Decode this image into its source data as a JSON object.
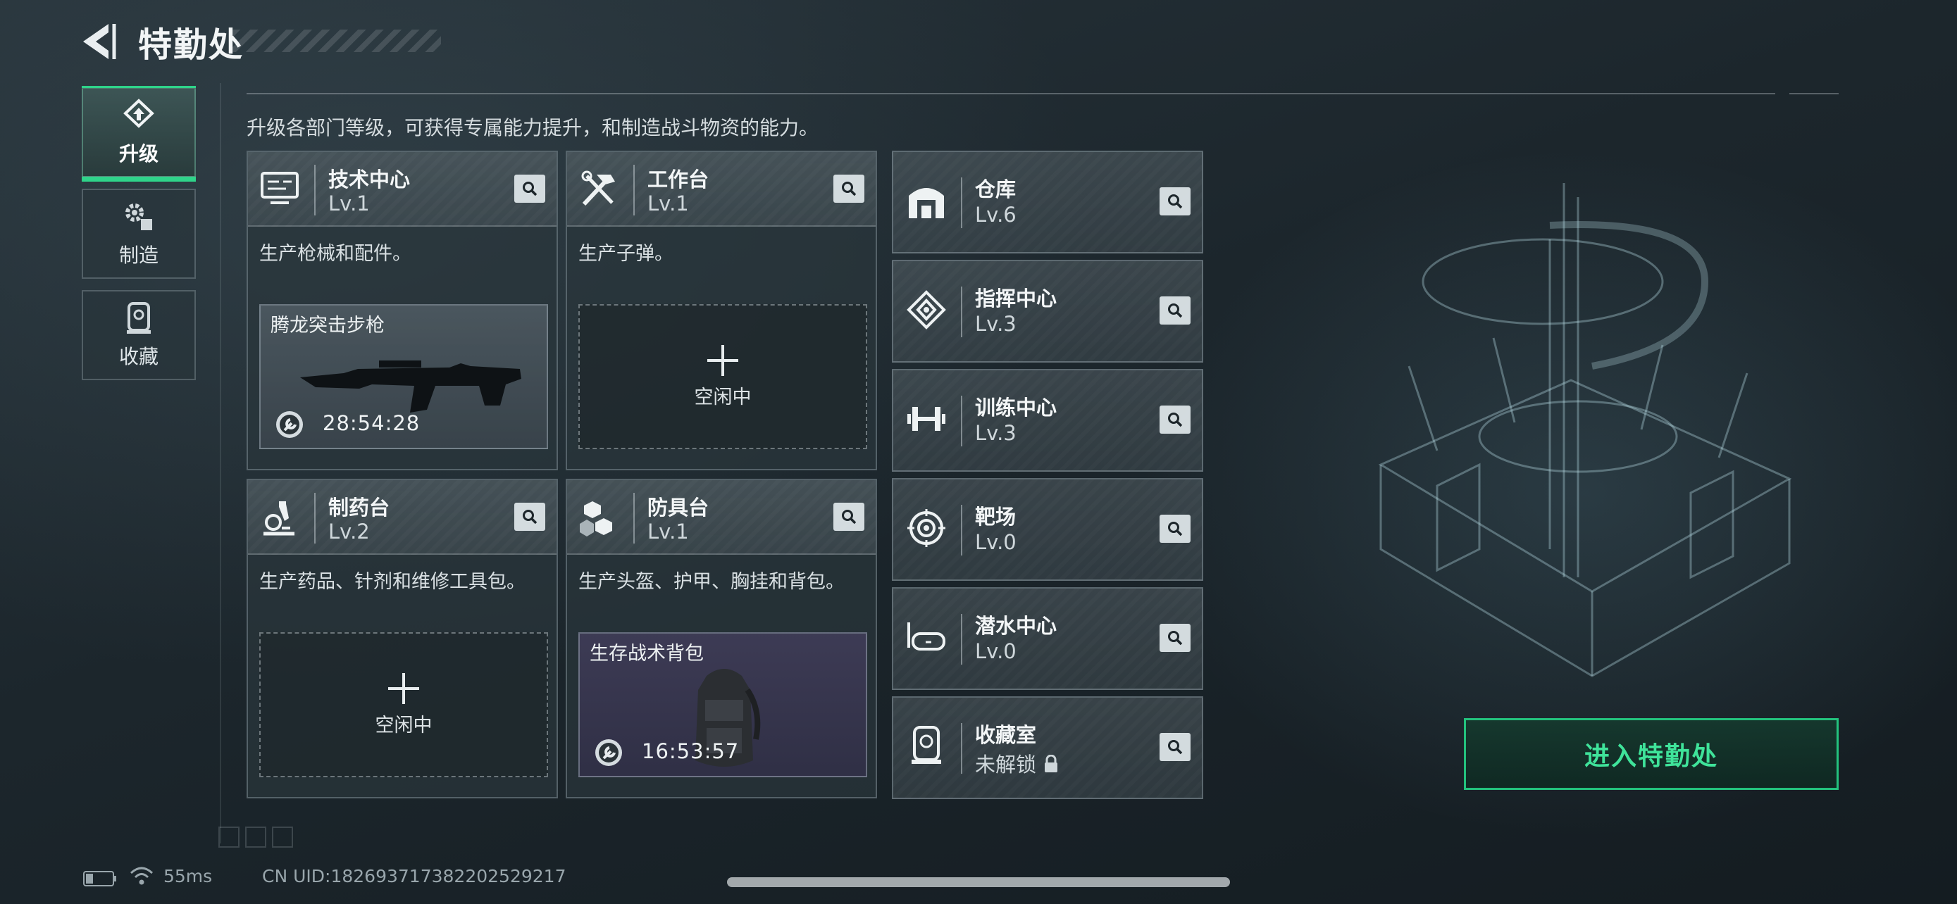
{
  "header": {
    "title": "特勤处",
    "back_icon": "back-arrow-icon"
  },
  "nav": [
    {
      "label": "升级",
      "icon": "upgrade-icon",
      "active": true
    },
    {
      "label": "制造",
      "icon": "gears-icon",
      "active": false
    },
    {
      "label": "收藏",
      "icon": "collection-icon",
      "active": false
    }
  ],
  "intro": "升级各部门等级，可获得专属能力提升，和制造战斗物资的能力。",
  "departments": [
    {
      "name": "技术中心",
      "level": "Lv.1",
      "desc": "生产枪械和配件。",
      "icon": "tech-center-icon",
      "slot": {
        "status": "busy",
        "item": "腾龙突击步枪",
        "timer": "28:54:28"
      }
    },
    {
      "name": "工作台",
      "level": "Lv.1",
      "desc": "生产子弹。",
      "icon": "workbench-icon",
      "slot": {
        "status": "idle",
        "label": "空闲中"
      }
    },
    {
      "name": "制药台",
      "level": "Lv.2",
      "desc": "生产药品、针剂和维修工具包。",
      "icon": "pharmacy-icon",
      "slot": {
        "status": "idle",
        "label": "空闲中"
      }
    },
    {
      "name": "防具台",
      "level": "Lv.1",
      "desc": "生产头盔、护甲、胸挂和背包。",
      "icon": "armor-bench-icon",
      "slot": {
        "status": "busy",
        "item": "生存战术背包",
        "timer": "16:53:57"
      }
    }
  ],
  "facilities": [
    {
      "name": "仓库",
      "level": "Lv.6",
      "icon": "warehouse-icon"
    },
    {
      "name": "指挥中心",
      "level": "Lv.3",
      "icon": "command-center-icon"
    },
    {
      "name": "训练中心",
      "level": "Lv.3",
      "icon": "dumbbell-icon"
    },
    {
      "name": "靶场",
      "level": "Lv.0",
      "icon": "target-icon"
    },
    {
      "name": "潜水中心",
      "level": "Lv.0",
      "icon": "diving-mask-icon"
    },
    {
      "name": "收藏室",
      "level": "未解锁",
      "icon": "collection-room-icon",
      "locked": true
    }
  ],
  "enter_button": "进入特勤处",
  "status_bar": {
    "ping": "55ms",
    "uid": "CN UID:1826937173822025292​17"
  },
  "colors": {
    "accent": "#2fd48a",
    "button_text": "#3fe39a"
  }
}
